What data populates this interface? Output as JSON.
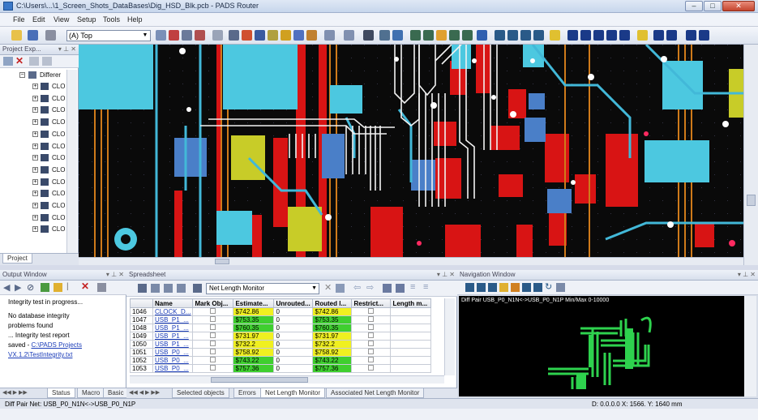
{
  "window": {
    "title": "C:\\Users\\...\\1_Screen_Shots_DataBases\\Dig_HSD_Blk.pcb - PADS Router",
    "min": "–",
    "max": "□",
    "close": "✕"
  },
  "menu": [
    "File",
    "Edit",
    "View",
    "Setup",
    "Tools",
    "Help"
  ],
  "toolbar": {
    "layer_value": "(A) Top"
  },
  "project_explorer": {
    "title": "Project Exp...",
    "root_label": "Differer",
    "items": [
      "CLO",
      "CLO",
      "CLO",
      "CLO",
      "CLO",
      "CLO",
      "CLO",
      "CLO",
      "CLO",
      "CLO",
      "CLO",
      "CLO",
      "CLO"
    ],
    "tab_label": "Project"
  },
  "output_window": {
    "title": "Output Window",
    "lines": [
      "Integrity test in progress...",
      "No database integrity",
      "problems found",
      "... Integrity test report",
      "saved -"
    ],
    "link1": "C:\\PADS Projects",
    "link2": "VX.1.2\\TestIntegrity.txt",
    "tabs": [
      "Status",
      "Macro",
      "Basic"
    ]
  },
  "spreadsheet": {
    "title": "Spreadsheet",
    "monitor_value": "Net Length Monitor",
    "columns": [
      "",
      "Name",
      "Mark Obj...",
      "Estimate...",
      "Unrouted...",
      "Routed l...",
      "Restrict...",
      "Length m..."
    ],
    "rows": [
      {
        "id": "1046",
        "name": "CLOCK_D...",
        "est": "$742.86",
        "unr": "0",
        "routed": "$742.86",
        "hl": "y"
      },
      {
        "id": "1047",
        "name": "USB_P1_...",
        "est": "$753.35",
        "unr": "0",
        "routed": "$753.35",
        "hl": "g"
      },
      {
        "id": "1048",
        "name": "USB_P1_...",
        "est": "$760.35",
        "unr": "0",
        "routed": "$760.35",
        "hl": "g"
      },
      {
        "id": "1049",
        "name": "USB_P1_...",
        "est": "$731.97",
        "unr": "0",
        "routed": "$731.97",
        "hl": "y"
      },
      {
        "id": "1050",
        "name": "USB_P1_...",
        "est": "$732.2",
        "unr": "0",
        "routed": "$732.2",
        "hl": "y"
      },
      {
        "id": "1051",
        "name": "USB_P0_...",
        "est": "$758.92",
        "unr": "0",
        "routed": "$758.92",
        "hl": "y"
      },
      {
        "id": "1052",
        "name": "USB_P0_...",
        "est": "$743.22",
        "unr": "0",
        "routed": "$743.22",
        "hl": "g"
      },
      {
        "id": "1053",
        "name": "USB_P0_...",
        "est": "$757.36",
        "unr": "0",
        "routed": "$757.36",
        "hl": "g"
      }
    ],
    "tabs": [
      "Selected objects",
      "Errors",
      "Net Length Monitor",
      "Associated Net Length Monitor"
    ]
  },
  "navigation_window": {
    "title": "Navigation Window",
    "caption": "Diff Pair USB_P0_N1N<->USB_P0_N1P Min/Max 0-10000"
  },
  "status": {
    "left": "Diff Pair Net: USB_P0_N1N<->USB_P0_N1P",
    "right": "D: 0.0.0.0  X: 1566.  Y: 1640  mm"
  },
  "colors": {
    "pad_cyan": "#4cc8e0",
    "copper_red": "#e01818",
    "trace_white": "#f2f2f2",
    "trace_orange": "#d08020",
    "nav_green": "#2ed24e"
  }
}
